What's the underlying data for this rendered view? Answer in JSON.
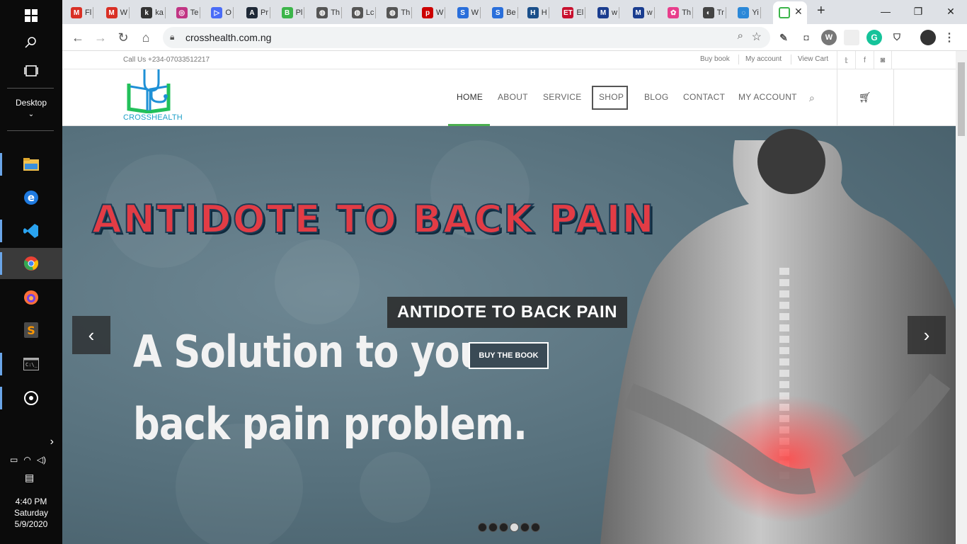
{
  "taskbar": {
    "desktop_label": "Desktop",
    "time": "4:40 PM",
    "day": "Saturday",
    "date": "5/9/2020"
  },
  "tabs": [
    {
      "fav": "M",
      "label": "Fl",
      "color": "#d93025"
    },
    {
      "fav": "M",
      "label": "W",
      "color": "#d93025"
    },
    {
      "fav": "k",
      "label": "ka",
      "color": "#333333"
    },
    {
      "fav": "◎",
      "label": "Te",
      "color": "#c13584"
    },
    {
      "fav": "▷",
      "label": "O",
      "color": "#4a6cf7"
    },
    {
      "fav": "A",
      "label": "Pr",
      "color": "#1f2937"
    },
    {
      "fav": "B",
      "label": "Pl",
      "color": "#3cb54a"
    },
    {
      "fav": "◍",
      "label": "Th",
      "color": "#555555"
    },
    {
      "fav": "◍",
      "label": "Lc",
      "color": "#555555"
    },
    {
      "fav": "◍",
      "label": "Th",
      "color": "#555555"
    },
    {
      "fav": "p",
      "label": "W",
      "color": "#cc0000"
    },
    {
      "fav": "S",
      "label": "W",
      "color": "#2a6fdb"
    },
    {
      "fav": "S",
      "label": "Be",
      "color": "#2a6fdb"
    },
    {
      "fav": "H",
      "label": "H",
      "color": "#1a4f8a"
    },
    {
      "fav": "ET",
      "label": "El",
      "color": "#c8102e"
    },
    {
      "fav": "M",
      "label": "w",
      "color": "#1a3d8f"
    },
    {
      "fav": "M",
      "label": "w",
      "color": "#1a3d8f"
    },
    {
      "fav": "✿",
      "label": "Th",
      "color": "#e83e8c"
    },
    {
      "fav": "◐",
      "label": "Tr",
      "color": "#444444"
    },
    {
      "fav": "◌",
      "label": "Yi",
      "color": "#2b88d8"
    }
  ],
  "toolbar": {
    "url": "crosshealth.com.ng"
  },
  "site": {
    "phone": "Call Us +234-07033512217",
    "top_links": [
      "Buy book",
      "My account",
      "View Cart"
    ],
    "logo_text": "CROSSHEALTH",
    "menu": [
      "HOME",
      "ABOUT",
      "SERVICE",
      "SHOP",
      "BLOG",
      "CONTACT",
      "MY ACCOUNT"
    ]
  },
  "hero": {
    "title_art": "ANTIDOTE TO BACK PAIN",
    "caption": "ANTIDOTE TO BACK PAIN",
    "line1": "A Solution to your",
    "line2": "back pain problem.",
    "button": "BUY THE BOOK",
    "slides_total": 6,
    "active_slide": 4
  }
}
